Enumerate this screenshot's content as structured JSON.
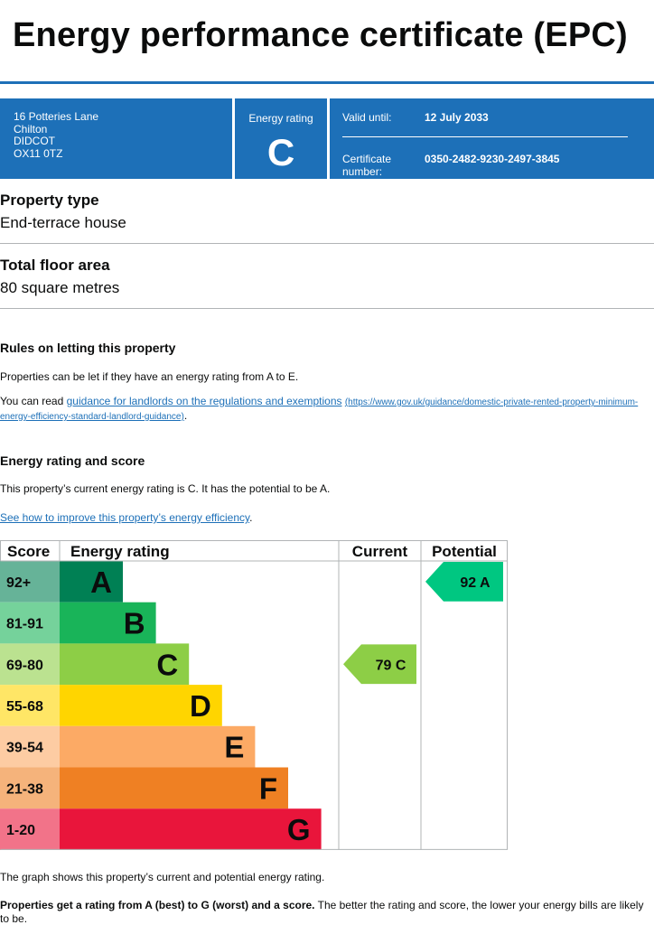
{
  "title": "Energy performance certificate (EPC)",
  "banner": {
    "address_lines": [
      "16 Potteries Lane",
      "Chilton",
      "DIDCOT",
      "OX11 0TZ"
    ],
    "energy_rating_label": "Energy rating",
    "energy_rating": "C",
    "valid_until_label": "Valid until:",
    "valid_until": "12 July 2033",
    "certificate_number_label_1": "Certificate",
    "certificate_number_label_2": "number:",
    "certificate_number": "0350-2482-9230-2497-3845"
  },
  "property_type": {
    "heading": "Property type",
    "value": "End-terrace house"
  },
  "floor_area": {
    "heading": "Total floor area",
    "value": "80 square metres"
  },
  "letting": {
    "heading": "Rules on letting this property",
    "para1": "Properties can be let if they have an energy rating from A to E.",
    "para2_prefix": "You can read ",
    "para2_link": "guidance for landlords on the regulations and exemptions",
    "para2_url_1": "(https://www.gov.uk/guidance/domestic-private-rented-property-minimum-",
    "para2_url_2": "energy-efficiency-standard-landlord-guidance)",
    "para2_suffix": "."
  },
  "rating_section": {
    "heading": "Energy rating and score",
    "para": "This property’s current energy rating is C. It has the potential to be A.",
    "improve_link": "See how to improve this property’s energy efficiency",
    "improve_suffix": "."
  },
  "chart_data": {
    "type": "bar",
    "headers": {
      "score": "Score",
      "rating": "Energy rating",
      "current": "Current",
      "potential": "Potential"
    },
    "bands": [
      {
        "score": "92+",
        "letter": "A",
        "color": "#008054",
        "score_bg": "#66b398"
      },
      {
        "score": "81-91",
        "letter": "B",
        "color": "#19b459",
        "score_bg": "#75d29b"
      },
      {
        "score": "69-80",
        "letter": "C",
        "color": "#8dce46",
        "score_bg": "#bbe290"
      },
      {
        "score": "55-68",
        "letter": "D",
        "color": "#ffd500",
        "score_bg": "#ffe666"
      },
      {
        "score": "39-54",
        "letter": "E",
        "color": "#fcaa65",
        "score_bg": "#fdcca3"
      },
      {
        "score": "21-38",
        "letter": "F",
        "color": "#ef8023",
        "score_bg": "#f5b37b"
      },
      {
        "score": "1-20",
        "letter": "G",
        "color": "#e9153b",
        "score_bg": "#f27389"
      }
    ],
    "current": {
      "score": 79,
      "letter": "C",
      "label": "79  C",
      "color": "#8dce46"
    },
    "potential": {
      "score": 92,
      "letter": "A",
      "label": "92  A",
      "color": "#00c781"
    }
  },
  "footer": {
    "para1": "The graph shows this property’s current and potential energy rating.",
    "para2_bold": "Properties get a rating from A (best) to G (worst) and a score.",
    "para2_rest": " The better the rating and score, the lower your energy bills are likely to be."
  }
}
